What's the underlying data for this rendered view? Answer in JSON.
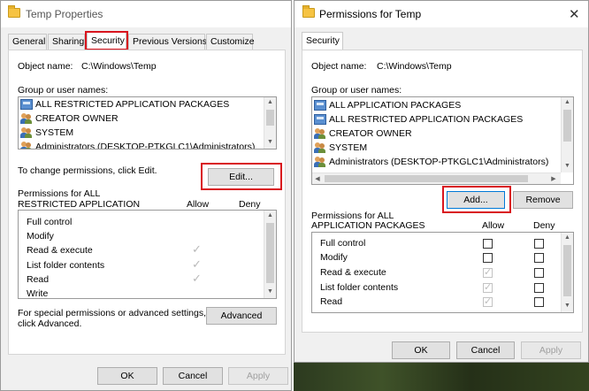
{
  "left_window": {
    "title": "Temp Properties",
    "tabs": [
      "General",
      "Sharing",
      "Security",
      "Previous Versions",
      "Customize"
    ],
    "object_name_label": "Object name:",
    "object_name_value": "C:\\Windows\\Temp",
    "group_label": "Group or user names:",
    "users": [
      "ALL RESTRICTED APPLICATION PACKAGES",
      "CREATOR OWNER",
      "SYSTEM",
      "Administrators (DESKTOP-PTKGLC1\\Administrators)"
    ],
    "change_text": "To change permissions, click Edit.",
    "edit_button": "Edit...",
    "perms_for_line1": "Permissions for ALL",
    "perms_for_line2": "RESTRICTED APPLICATION",
    "allow_header": "Allow",
    "deny_header": "Deny",
    "permissions": [
      {
        "name": "Full control",
        "allow": false
      },
      {
        "name": "Modify",
        "allow": false
      },
      {
        "name": "Read & execute",
        "allow": true
      },
      {
        "name": "List folder contents",
        "allow": true
      },
      {
        "name": "Read",
        "allow": true
      },
      {
        "name": "Write",
        "allow": false
      }
    ],
    "special_line1": "For special permissions or advanced settings,",
    "special_line2": "click Advanced.",
    "advanced_button": "Advanced",
    "ok_button": "OK",
    "cancel_button": "Cancel",
    "apply_button": "Apply"
  },
  "right_window": {
    "title": "Permissions for Temp",
    "close_glyph": "✕",
    "tab": "Security",
    "object_name_label": "Object name:",
    "object_name_value": "C:\\Windows\\Temp",
    "group_label": "Group or user names:",
    "users": [
      "ALL APPLICATION PACKAGES",
      "ALL RESTRICTED APPLICATION PACKAGES",
      "CREATOR OWNER",
      "SYSTEM",
      "Administrators (DESKTOP-PTKGLC1\\Administrators)"
    ],
    "add_button": "Add...",
    "remove_button": "Remove",
    "perms_for_line1": "Permissions for ALL",
    "perms_for_line2": "APPLICATION PACKAGES",
    "allow_header": "Allow",
    "deny_header": "Deny",
    "permissions": [
      {
        "name": "Full control",
        "allow": false,
        "allow_disabled": false
      },
      {
        "name": "Modify",
        "allow": false,
        "allow_disabled": false
      },
      {
        "name": "Read & execute",
        "allow": true,
        "allow_disabled": true
      },
      {
        "name": "List folder contents",
        "allow": true,
        "allow_disabled": true
      },
      {
        "name": "Read",
        "allow": true,
        "allow_disabled": true
      }
    ],
    "ok_button": "OK",
    "cancel_button": "Cancel",
    "apply_button": "Apply"
  },
  "colors": {
    "highlight_box": "#d9151e",
    "focus_border": "#0078d7"
  }
}
